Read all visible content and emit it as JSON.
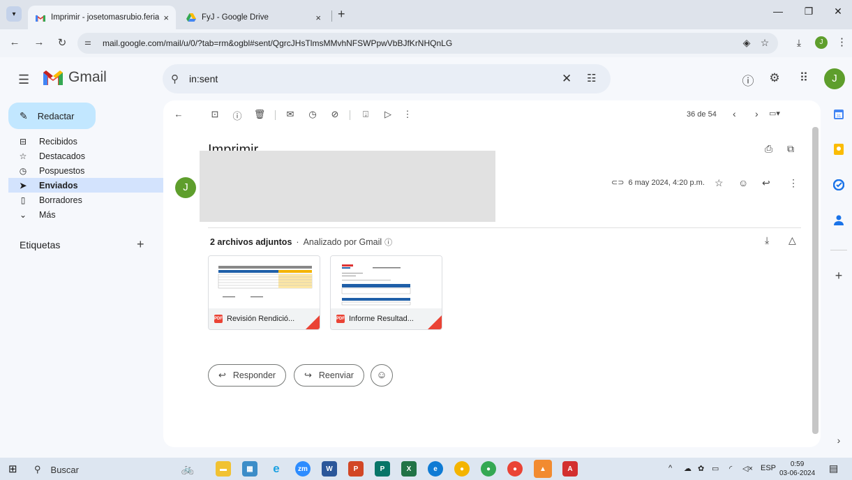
{
  "browser": {
    "tabs": [
      {
        "title": "Imprimir - josetomasrubio.feria",
        "close": "×",
        "active": true
      },
      {
        "title": "FyJ - Google Drive",
        "close": "×",
        "active": false
      }
    ],
    "new_tab": "+",
    "url": "mail.google.com/mail/u/0/?tab=rm&ogbl#sent/QgrcJHsTlmsMMvhNFSWPpwVbBJfKrNHQnLG",
    "profile_initial": "J"
  },
  "gmail": {
    "logo_text": "Gmail",
    "search_value": "in:sent",
    "avatar_initial": "J"
  },
  "sidebar": {
    "compose_label": "Redactar",
    "items": [
      {
        "label": "Recibidos",
        "icon": "inbox-icon"
      },
      {
        "label": "Destacados",
        "icon": "star-icon"
      },
      {
        "label": "Pospuestos",
        "icon": "clock-icon"
      },
      {
        "label": "Enviados",
        "icon": "send-icon",
        "selected": true
      },
      {
        "label": "Borradores",
        "icon": "draft-icon"
      },
      {
        "label": "Más",
        "icon": "chevron-down-icon"
      }
    ],
    "labels_title": "Etiquetas"
  },
  "toolbar": {
    "pager_text": "36 de 54"
  },
  "message": {
    "subject": "Imprimir",
    "sender_initial": "J",
    "date": "6 may 2024, 4:20 p.m."
  },
  "attachments": {
    "count_label": "2 archivos adjuntos",
    "scanned_label": "Analizado por Gmail",
    "files": [
      {
        "name": "Revisión Rendició...",
        "type": "PDF"
      },
      {
        "name": "Informe Resultad...",
        "type": "PDF"
      }
    ]
  },
  "actions": {
    "reply_label": "Responder",
    "forward_label": "Reenviar"
  },
  "taskbar": {
    "search_label": "Buscar",
    "lang": "ESP",
    "time": "0:59",
    "date": "03-06-2024"
  },
  "colors": {
    "compose_bg": "#c2e7ff",
    "selected_nav": "#d3e3fd",
    "avatar": "#5e9e2c",
    "pdf_red": "#ea4335"
  }
}
